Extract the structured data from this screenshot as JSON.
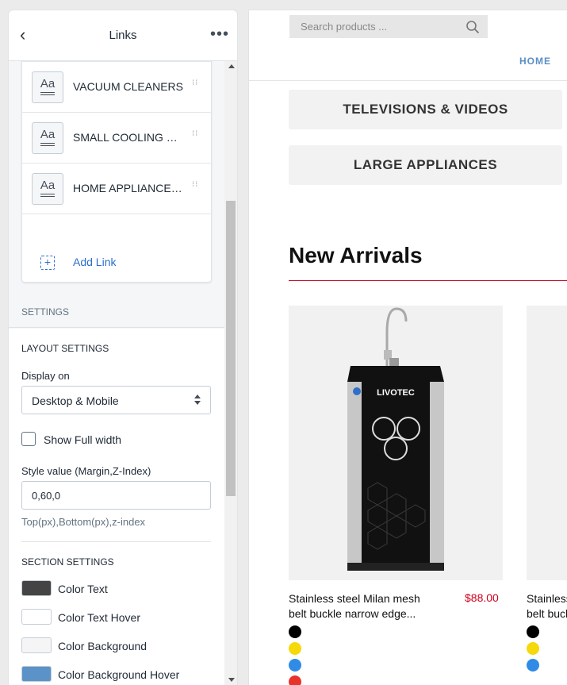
{
  "panel": {
    "title": "Links",
    "back_icon": "chevron-left-icon",
    "more_icon": "more-horizontal-icon",
    "links": [
      {
        "label": "VACUUM CLEANERS"
      },
      {
        "label": "SMALL COOLING & ..."
      },
      {
        "label": "HOME APPLIANCES ..."
      }
    ],
    "link_icon_glyph": "Aa",
    "add_link_label": "Add Link",
    "settings_heading": "SETTINGS",
    "layout": {
      "heading": "LAYOUT SETTINGS",
      "display_on_label": "Display on",
      "display_on_value": "Desktop & Mobile",
      "show_full_width_label": "Show Full width",
      "show_full_width_checked": false,
      "style_label": "Style value (Margin,Z-Index)",
      "style_value": "0,60,0",
      "style_help": "Top(px),Bottom(px),z-index"
    },
    "section": {
      "heading": "SECTION SETTINGS",
      "colors": [
        {
          "label": "Color Text",
          "color": "#444444"
        },
        {
          "label": "Color Text Hover",
          "color": "#ffffff"
        },
        {
          "label": "Color Background",
          "color": "#f5f5f5"
        },
        {
          "label": "Color Background Hover",
          "color": "#5b93c9"
        }
      ]
    }
  },
  "preview": {
    "search_placeholder": "Search products ...",
    "nav_home": "HOME",
    "categories": [
      "TELEVISIONS & VIDEOS",
      "LARGE APPLIANCES"
    ],
    "section_title": "New Arrivals",
    "products": [
      {
        "name": "Stainless steel Milan mesh belt buckle narrow edge...",
        "price": "$88.00",
        "colors": [
          "#000000",
          "#f5d90a",
          "#2f8be6",
          "#e8342b"
        ],
        "brand": "LIVOTEC"
      },
      {
        "name": "Stainless steel Milan mesh belt buckle narrow edge...",
        "price": "",
        "colors": [
          "#000000",
          "#f5d90a",
          "#2f8be6"
        ]
      }
    ]
  }
}
